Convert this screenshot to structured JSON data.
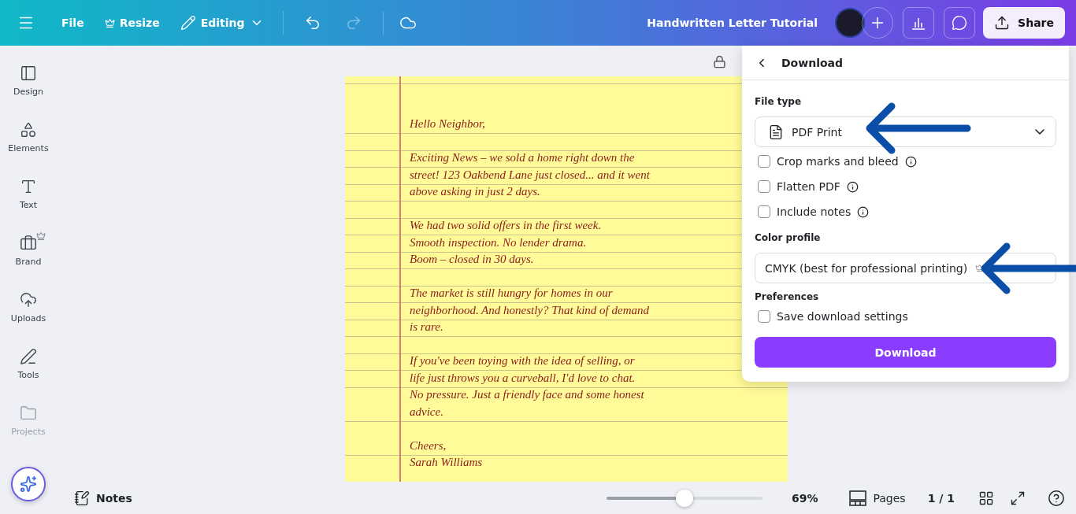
{
  "toolbar": {
    "items": [
      {
        "label": "File",
        "kind": "plain"
      },
      {
        "label": "Resize",
        "kind": "premium"
      },
      {
        "label": "Editing",
        "kind": "mode"
      }
    ],
    "title": "Handwritten Letter Tutorial",
    "share": "Share"
  },
  "sidebar": {
    "items": [
      {
        "label": "Design",
        "kind": "design",
        "premium": false,
        "muted": false
      },
      {
        "label": "Elements",
        "kind": "elements",
        "premium": false,
        "muted": false
      },
      {
        "label": "Text",
        "kind": "text",
        "premium": false,
        "muted": false
      },
      {
        "label": "Brand",
        "kind": "brand",
        "premium": true,
        "muted": false
      },
      {
        "label": "Uploads",
        "kind": "uploads",
        "premium": false,
        "muted": false
      },
      {
        "label": "Tools",
        "kind": "tools",
        "premium": false,
        "muted": false
      },
      {
        "label": "Projects",
        "kind": "projects",
        "premium": false,
        "muted": true
      }
    ]
  },
  "letter": {
    "paragraphs": [
      [
        "Hello Neighbor,"
      ],
      [
        "Exciting News – we sold a home right down the",
        "street! 123 Oakbend Lane just closed... and it went",
        "above asking in just 2 days."
      ],
      [
        "We had two solid offers in the first week.",
        "Smooth inspection. No lender drama.",
        "Boom – closed in 30 days."
      ],
      [
        "The market is still hungry for homes in our",
        "neighborhood. And honestly? That kind of demand",
        "is rare."
      ],
      [
        "If you've been toying with the idea of selling, or",
        "life just throws you a curveball, I'd love to chat.",
        "No pressure. Just a friendly face and some honest",
        "advice."
      ],
      [
        "Cheers,",
        "Sarah Williams"
      ]
    ]
  },
  "download_panel": {
    "title": "Download",
    "file_type": {
      "label": "File type",
      "value": "PDF Print"
    },
    "options": [
      {
        "label": "Crop marks and bleed",
        "checked": false,
        "info": true
      },
      {
        "label": "Flatten PDF",
        "checked": false,
        "info": true
      },
      {
        "label": "Include notes",
        "checked": false,
        "info": true
      }
    ],
    "color_profile": {
      "label": "Color profile",
      "value": "CMYK (best for professional printing)",
      "premium": true
    },
    "preferences": {
      "label": "Preferences",
      "options": [
        {
          "label": "Save download settings",
          "checked": false
        }
      ]
    },
    "button": "Download"
  },
  "bottom_bar": {
    "notes": "Notes",
    "zoom": {
      "level": 0.5
    },
    "zoom_reading": "69%",
    "pages": "Pages",
    "page_count": "1 / 1"
  }
}
